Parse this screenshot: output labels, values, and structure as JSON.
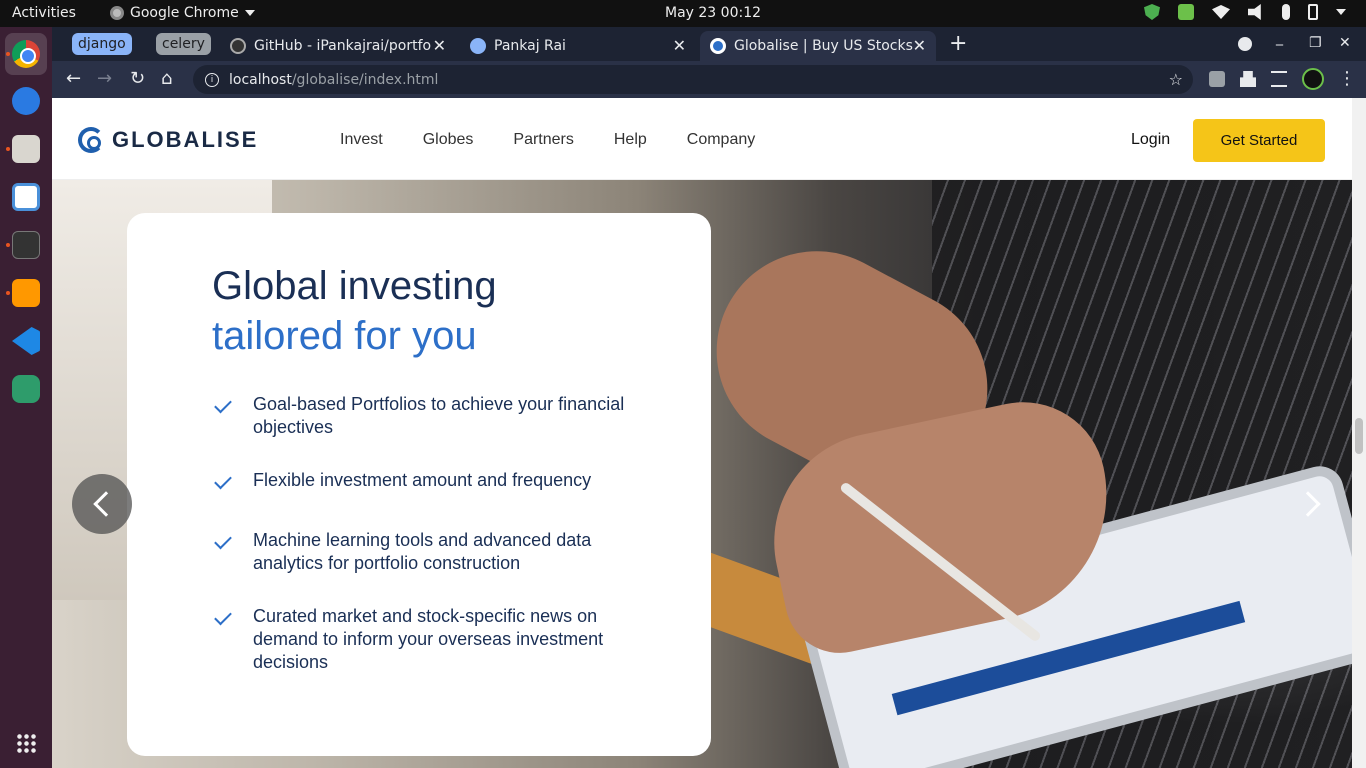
{
  "system": {
    "activities": "Activities",
    "app_name": "Google Chrome",
    "clock": "May 23  00:12"
  },
  "browser": {
    "tab_groups": [
      {
        "label": "django",
        "color": "#8ab4f8"
      },
      {
        "label": "celery",
        "color": "#9aa0a6"
      }
    ],
    "tabs": [
      {
        "title": "GitHub - iPankajrai/portfo",
        "icon": "github-icon",
        "active": false
      },
      {
        "title": "Pankaj Rai",
        "icon": "globe-icon",
        "active": false
      },
      {
        "title": "Globalise | Buy US Stocks ",
        "icon": "globalise-icon",
        "active": true
      }
    ],
    "url_host": "localhost",
    "url_path": "/globalise/index.html"
  },
  "site": {
    "logo_text": "GLOBALISE",
    "nav": [
      "Invest",
      "Globes",
      "Partners",
      "Help",
      "Company"
    ],
    "login": "Login",
    "cta": "Get Started",
    "cta_color": "#f5c518",
    "hero": {
      "title_line1": "Global investing",
      "title_line2": "tailored for you",
      "features": [
        "Goal-based Portfolios to achieve your financial objectives",
        "Flexible investment amount and frequency",
        "Machine learning tools and advanced data analytics for portfolio construction",
        "Curated market and stock-specific news on demand to inform your overseas investment decisions"
      ]
    }
  }
}
